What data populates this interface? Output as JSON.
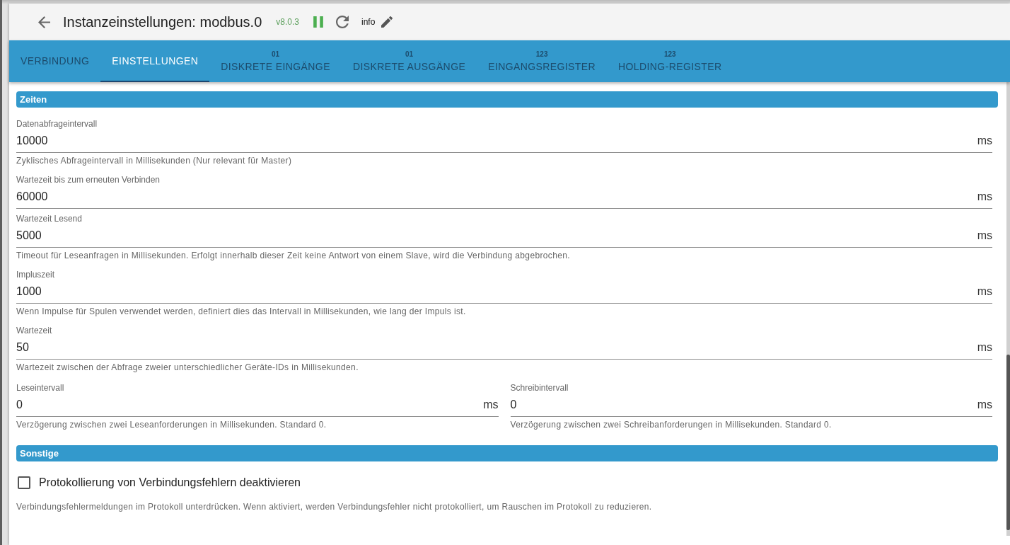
{
  "header": {
    "title": "Instanzeinstellungen: modbus.0",
    "version": "v8.0.3",
    "running": true,
    "note": "info"
  },
  "tabs": [
    {
      "label": "VERBINDUNG",
      "selected": false
    },
    {
      "label": "EINSTELLUNGEN",
      "selected": true
    },
    {
      "glyph": "01",
      "label": "DISKRETE EINGÄNGE",
      "selected": false
    },
    {
      "glyph": "01",
      "label": "DISKRETE AUSGÄNGE",
      "selected": false
    },
    {
      "glyph": "123",
      "label": "EINGANGSREGISTER",
      "selected": false
    },
    {
      "glyph": "123",
      "label": "HOLDING-REGISTER",
      "selected": false
    }
  ],
  "sections": [
    {
      "title": "Zeiten",
      "items": [
        {
          "kind": "number",
          "label": "Datenabfrageintervall",
          "value": "10000",
          "unit": "ms",
          "help": "Zyklisches Abfrageintervall in Millisekunden (Nur relevant für Master)"
        },
        {
          "kind": "number",
          "label": "Wartezeit bis zum erneuten Verbinden",
          "value": "60000",
          "unit": "ms"
        },
        {
          "kind": "number",
          "label": "Wartezeit Lesend",
          "value": "5000",
          "unit": "ms",
          "help": "Timeout für Leseanfragen in Millisekunden. Erfolgt innerhalb dieser Zeit keine Antwort von einem Slave, wird die Verbindung abgebrochen."
        },
        {
          "kind": "number",
          "label": "Impluszeit",
          "value": "1000",
          "unit": "ms",
          "help": "Wenn Impulse für Spulen verwendet werden, definiert dies das Intervall in Millisekunden, wie lang der Impuls ist."
        },
        {
          "kind": "number",
          "label": "Wartezeit",
          "value": "50",
          "unit": "ms",
          "help": "Wartezeit zwischen der Abfrage zweier unterschiedlicher Geräte-IDs in Millisekunden."
        },
        {
          "kind": "pair",
          "fields": [
            {
              "label": "Leseintervall",
              "value": "0",
              "unit": "ms",
              "help": "Verzögerung zwischen zwei Leseanforderungen in Millisekunden. Standard 0."
            },
            {
              "label": "Schreibintervall",
              "value": "0",
              "unit": "ms",
              "help": "Verzögerung zwischen zwei Schreibanforderungen in Millisekunden. Standard 0."
            }
          ]
        }
      ]
    },
    {
      "title": "Sonstige",
      "items": [
        {
          "kind": "checkbox",
          "label": "Protokollierung von Verbindungsfehlern deaktivieren",
          "checked": false,
          "help": "Verbindungsfehlermeldungen im Protokoll unterdrücken. Wenn aktiviert, werden Verbindungsfehler nicht protokolliert, um Rauschen im Protokoll zu reduzieren."
        }
      ]
    }
  ]
}
